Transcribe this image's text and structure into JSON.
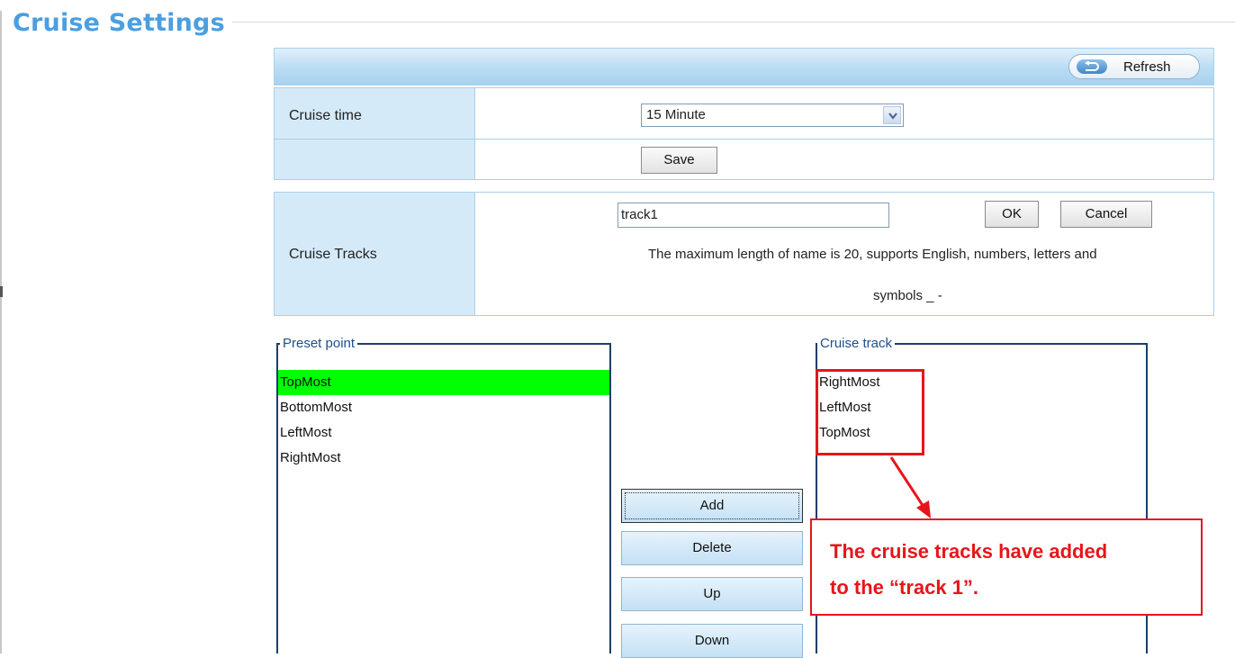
{
  "page": {
    "title": "Cruise Settings"
  },
  "header": {
    "refresh_label": "Refresh"
  },
  "cruise_time": {
    "label": "Cruise time",
    "selected": "15 Minute",
    "save_label": "Save"
  },
  "cruise_tracks": {
    "label": "Cruise Tracks",
    "name_value": "track1",
    "ok_label": "OK",
    "cancel_label": "Cancel",
    "hint_line1": "The maximum length of name is 20, supports English, numbers, letters and",
    "hint_line2": "symbols _ -"
  },
  "preset_point": {
    "legend": "Preset point",
    "items": [
      "TopMost",
      "BottomMost",
      "LeftMost",
      "RightMost"
    ],
    "selected_index": 0
  },
  "actions": {
    "add_label": "Add",
    "delete_label": "Delete",
    "up_label": "Up",
    "down_label": "Down"
  },
  "cruise_track": {
    "legend": "Cruise track",
    "items": [
      "RightMost",
      "LeftMost",
      "TopMost"
    ]
  },
  "annotation": {
    "line1": "The cruise tracks have added",
    "line2": "to the “track 1”."
  },
  "colors": {
    "title": "#4a9fe0",
    "selected_row": "#00ff00",
    "annotation_red": "#e8141b"
  }
}
